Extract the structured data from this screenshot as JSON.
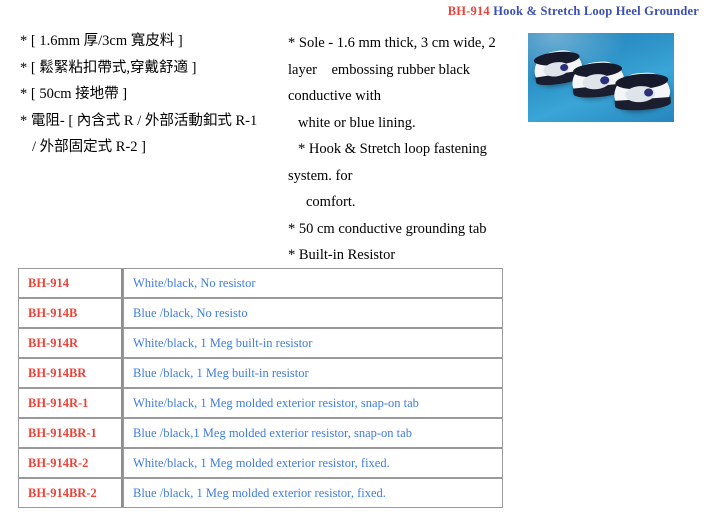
{
  "title": {
    "code": "BH-914",
    "rest": "Hook & Stretch Loop Heel Grounder"
  },
  "spec_cn": {
    "lines": [
      "* [ 1.6mm 厚/3cm 寬皮料  ]",
      "* [  鬆緊粘扣帶式,穿戴舒適  ]",
      "* [ 50cm  接地帶  ]",
      "*  電阻- [  內含式 R /  外部活動釦式 R-1",
      "/  外部固定式 R-2 ]"
    ]
  },
  "spec_en": {
    "lines": [
      "* Sole - 1.6 mm thick, 3 cm wide, 2",
      "layer    embossing rubber black",
      "conductive with",
      "white or blue lining.",
      "* Hook & Stretch loop fastening",
      "system. for",
      "comfort.",
      "* 50 cm conductive grounding tab",
      "* Built-in Resistor"
    ]
  },
  "photo": {
    "alt": "Three white ESD heel grounder clogs with black straps on a blue background"
  },
  "model_table": {
    "rows": [
      {
        "model": "BH-914",
        "desc": "White/black, No resistor"
      },
      {
        "model": "BH-914B",
        "desc": "Blue /black, No resisto"
      },
      {
        "model": "BH-914R",
        "desc": "White/black, 1 Meg built-in resistor"
      },
      {
        "model": "BH-914BR",
        "desc": "Blue /black, 1 Meg built-in resistor"
      },
      {
        "model": "BH-914R-1",
        "desc": "White/black, 1 Meg molded exterior resistor, snap-on tab"
      },
      {
        "model": "BH-914BR-1",
        "desc": "Blue /black,1 Meg molded exterior resistor, snap-on tab"
      },
      {
        "model": "BH-914R-2",
        "desc": "White/black, 1 Meg molded exterior resistor, fixed."
      },
      {
        "model": "BH-914BR-2",
        "desc": "Blue /black, 1 Meg molded exterior resistor, fixed."
      }
    ]
  },
  "colors": {
    "model_red": "#e8443a",
    "desc_blue": "#3f7ce0",
    "title_blue": "#3a4fb5",
    "photo_background": "#2d93c8",
    "table_border": "#9a9a9a"
  }
}
